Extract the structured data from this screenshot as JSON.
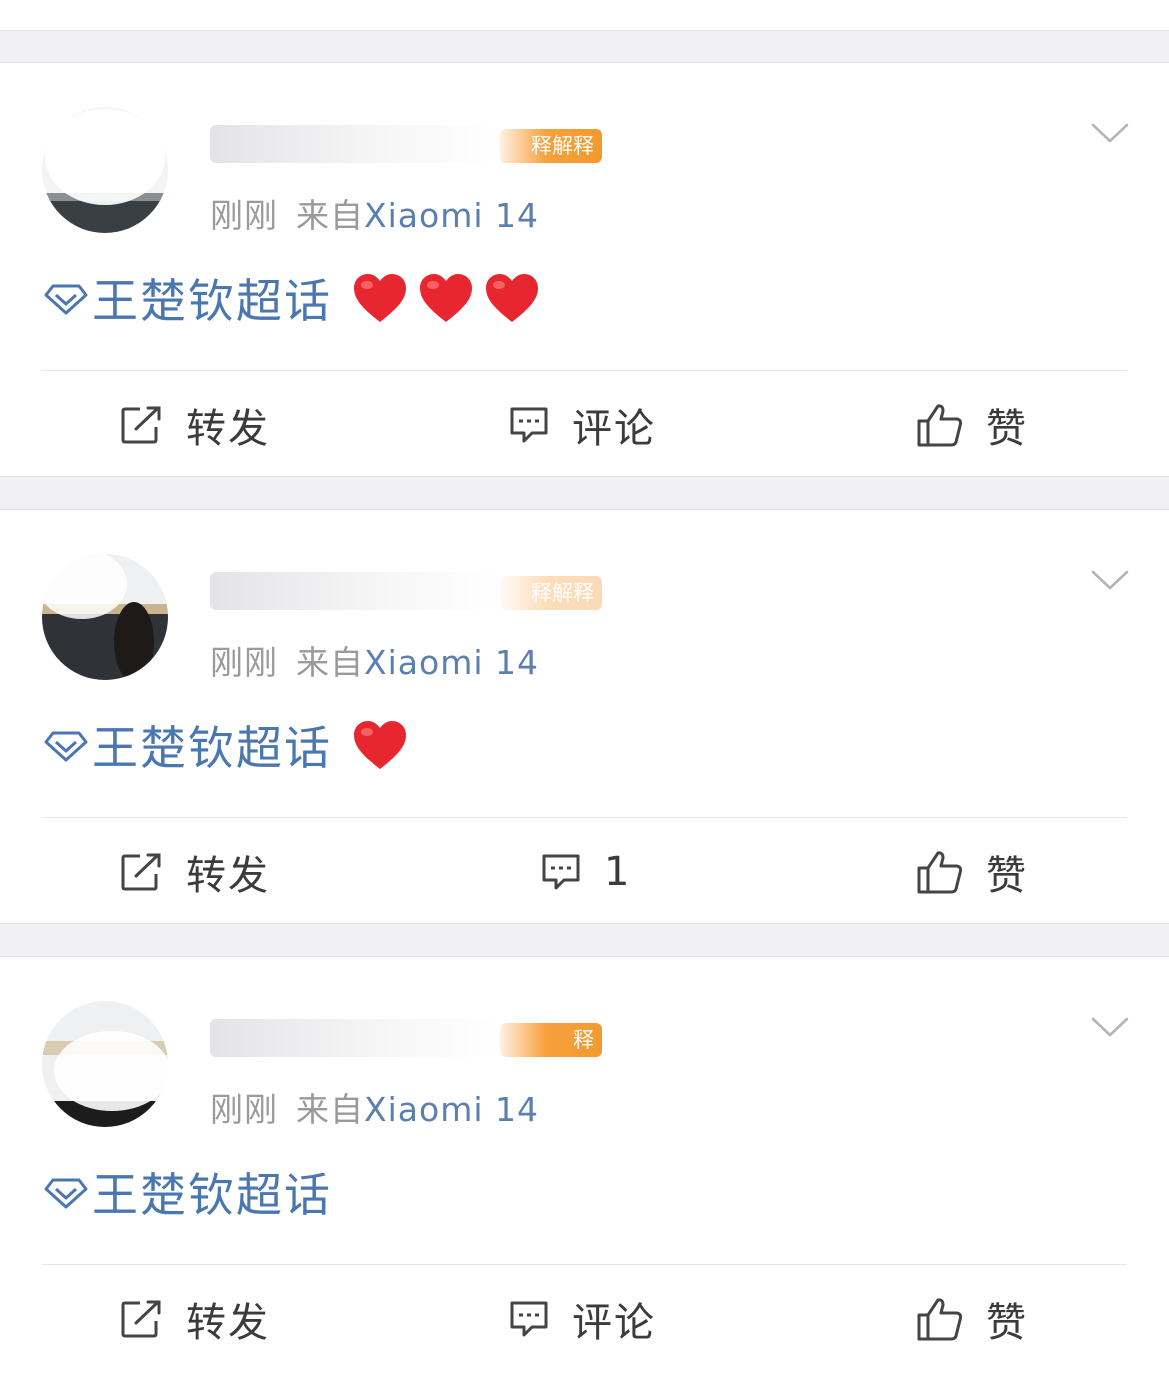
{
  "colors": {
    "topic_blue": "#4a77b0",
    "meta_gray": "#9a9a9a",
    "badge_orange": "#f7a03c",
    "heart_red": "#e8262f",
    "page_bg": "#f1f1f3"
  },
  "posts": [
    {
      "avatar_icon": "avatar-photo-icon",
      "badge_text": "释解释",
      "time": "刚刚",
      "source_label": "来自",
      "device": "Xiaomi 14",
      "topic": "王楚钦超话",
      "hearts": 3,
      "actions": {
        "repost": "转发",
        "comment": "评论",
        "like": "赞"
      }
    },
    {
      "avatar_icon": "avatar-photo-icon",
      "badge_text": "释解释",
      "time": "刚刚",
      "source_label": "来自",
      "device": "Xiaomi 14",
      "topic": "王楚钦超话",
      "hearts": 1,
      "actions": {
        "repost": "转发",
        "comment": "1",
        "like": "赞"
      }
    },
    {
      "avatar_icon": "avatar-photo-icon",
      "badge_text": "释",
      "time": "刚刚",
      "source_label": "来自",
      "device": "Xiaomi 14",
      "topic": "王楚钦超话",
      "hearts": 0,
      "actions": {
        "repost": "转发",
        "comment": "评论",
        "like": "赞"
      }
    }
  ]
}
